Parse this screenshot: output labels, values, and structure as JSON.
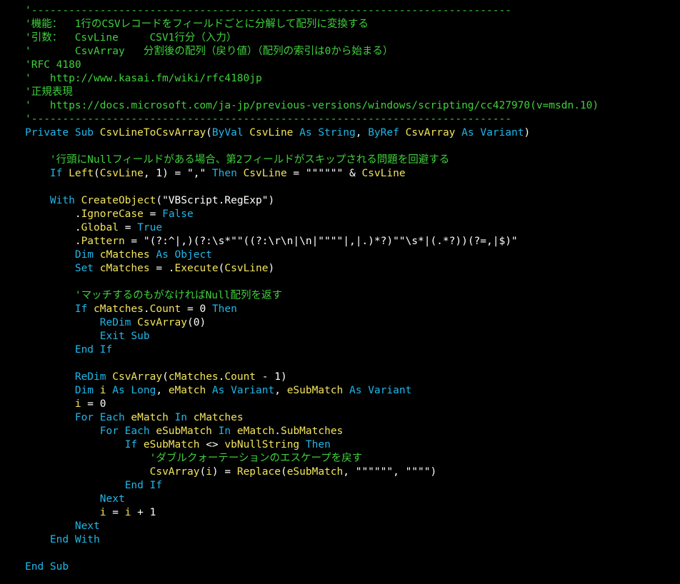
{
  "theme": {
    "background": "#000000",
    "keyword": "#1fb7e8",
    "identifier": "#f2e55c",
    "comment": "#3fd13c",
    "text": "#ffffff"
  },
  "lines": [
    [
      [
        "cm",
        "'-----------------------------------------------------------------------------"
      ]
    ],
    [
      [
        "cm",
        "'機能：  1行のCSVレコードをフィールドごとに分解して配列に変換する"
      ]
    ],
    [
      [
        "cm",
        "'引数：  CsvLine     CSV1行分（入力）"
      ]
    ],
    [
      [
        "cm",
        "'       CsvArray   分割後の配列（戻り値）（配列の索引は0から始まる）"
      ]
    ],
    [
      [
        "cm",
        "'RFC 4180"
      ]
    ],
    [
      [
        "cm",
        "'   http://www.kasai.fm/wiki/rfc4180jp"
      ]
    ],
    [
      [
        "cm",
        "'正規表現"
      ]
    ],
    [
      [
        "cm",
        "'   https://docs.microsoft.com/ja-jp/previous-versions/windows/scripting/cc427970(v=msdn.10)"
      ]
    ],
    [
      [
        "cm",
        "'-----------------------------------------------------------------------------"
      ]
    ],
    [
      [
        "kw",
        "Private Sub "
      ],
      [
        "id",
        "CsvLineToCsvArray"
      ],
      [
        "tx",
        "("
      ],
      [
        "kw",
        "ByVal "
      ],
      [
        "id",
        "CsvLine "
      ],
      [
        "kw",
        "As String"
      ],
      [
        "tx",
        ", "
      ],
      [
        "kw",
        "ByRef "
      ],
      [
        "id",
        "CsvArray "
      ],
      [
        "kw",
        "As Variant"
      ],
      [
        "tx",
        ")"
      ]
    ],
    [],
    [
      [
        "tx",
        "    "
      ],
      [
        "cm",
        "'行頭にNullフィールドがある場合、第2フィールドがスキップされる問題を回避する"
      ]
    ],
    [
      [
        "tx",
        "    "
      ],
      [
        "kw",
        "If "
      ],
      [
        "id",
        "Left"
      ],
      [
        "tx",
        "("
      ],
      [
        "id",
        "CsvLine"
      ],
      [
        "tx",
        ", 1) = \",\" "
      ],
      [
        "kw",
        "Then "
      ],
      [
        "id",
        "CsvLine"
      ],
      [
        "tx",
        " = \"\"\"\"\"\" & "
      ],
      [
        "id",
        "CsvLine"
      ]
    ],
    [],
    [
      [
        "tx",
        "    "
      ],
      [
        "kw",
        "With "
      ],
      [
        "id",
        "CreateObject"
      ],
      [
        "tx",
        "(\"VBScript.RegExp\")"
      ]
    ],
    [
      [
        "tx",
        "        ."
      ],
      [
        "id",
        "IgnoreCase"
      ],
      [
        "tx",
        " = "
      ],
      [
        "kw",
        "False"
      ]
    ],
    [
      [
        "tx",
        "        ."
      ],
      [
        "id",
        "Global"
      ],
      [
        "tx",
        " = "
      ],
      [
        "kw",
        "True"
      ]
    ],
    [
      [
        "tx",
        "        ."
      ],
      [
        "id",
        "Pattern"
      ],
      [
        "tx",
        " = \"(?:^|,)(?:\\s*\"\"((?:\\r\\n|\\n|\"\"\"\"|,|.)*?)\"\"\\s*|(.*?))(?=,|$)\""
      ]
    ],
    [
      [
        "tx",
        "        "
      ],
      [
        "kw",
        "Dim "
      ],
      [
        "id",
        "cMatches "
      ],
      [
        "kw",
        "As Object"
      ]
    ],
    [
      [
        "tx",
        "        "
      ],
      [
        "kw",
        "Set "
      ],
      [
        "id",
        "cMatches"
      ],
      [
        "tx",
        " = ."
      ],
      [
        "id",
        "Execute"
      ],
      [
        "tx",
        "("
      ],
      [
        "id",
        "CsvLine"
      ],
      [
        "tx",
        ")"
      ]
    ],
    [],
    [
      [
        "tx",
        "        "
      ],
      [
        "cm",
        "'マッチするのもがなければNull配列を返す"
      ]
    ],
    [
      [
        "tx",
        "        "
      ],
      [
        "kw",
        "If "
      ],
      [
        "id",
        "cMatches"
      ],
      [
        "tx",
        "."
      ],
      [
        "id",
        "Count"
      ],
      [
        "tx",
        " = 0 "
      ],
      [
        "kw",
        "Then"
      ]
    ],
    [
      [
        "tx",
        "            "
      ],
      [
        "kw",
        "ReDim "
      ],
      [
        "id",
        "CsvArray"
      ],
      [
        "tx",
        "(0)"
      ]
    ],
    [
      [
        "tx",
        "            "
      ],
      [
        "kw",
        "Exit Sub"
      ]
    ],
    [
      [
        "tx",
        "        "
      ],
      [
        "kw",
        "End If"
      ]
    ],
    [],
    [
      [
        "tx",
        "        "
      ],
      [
        "kw",
        "ReDim "
      ],
      [
        "id",
        "CsvArray"
      ],
      [
        "tx",
        "("
      ],
      [
        "id",
        "cMatches"
      ],
      [
        "tx",
        "."
      ],
      [
        "id",
        "Count"
      ],
      [
        "tx",
        " - 1)"
      ]
    ],
    [
      [
        "tx",
        "        "
      ],
      [
        "kw",
        "Dim "
      ],
      [
        "id",
        "i "
      ],
      [
        "kw",
        "As Long"
      ],
      [
        "tx",
        ", "
      ],
      [
        "id",
        "eMatch "
      ],
      [
        "kw",
        "As Variant"
      ],
      [
        "tx",
        ", "
      ],
      [
        "id",
        "eSubMatch "
      ],
      [
        "kw",
        "As Variant"
      ]
    ],
    [
      [
        "tx",
        "        "
      ],
      [
        "id",
        "i"
      ],
      [
        "tx",
        " = 0"
      ]
    ],
    [
      [
        "tx",
        "        "
      ],
      [
        "kw",
        "For Each "
      ],
      [
        "id",
        "eMatch "
      ],
      [
        "kw",
        "In "
      ],
      [
        "id",
        "cMatches"
      ]
    ],
    [
      [
        "tx",
        "            "
      ],
      [
        "kw",
        "For Each "
      ],
      [
        "id",
        "eSubMatch "
      ],
      [
        "kw",
        "In "
      ],
      [
        "id",
        "eMatch"
      ],
      [
        "tx",
        "."
      ],
      [
        "id",
        "SubMatches"
      ]
    ],
    [
      [
        "tx",
        "                "
      ],
      [
        "kw",
        "If "
      ],
      [
        "id",
        "eSubMatch"
      ],
      [
        "tx",
        " <> "
      ],
      [
        "id",
        "vbNullString "
      ],
      [
        "kw",
        "Then"
      ]
    ],
    [
      [
        "tx",
        "                    "
      ],
      [
        "cm",
        "'ダブルクォーテーションのエスケープを戻す"
      ]
    ],
    [
      [
        "tx",
        "                    "
      ],
      [
        "id",
        "CsvArray"
      ],
      [
        "tx",
        "("
      ],
      [
        "id",
        "i"
      ],
      [
        "tx",
        ") = "
      ],
      [
        "id",
        "Replace"
      ],
      [
        "tx",
        "("
      ],
      [
        "id",
        "eSubMatch"
      ],
      [
        "tx",
        ", \"\"\"\"\"\", \"\"\"\")"
      ]
    ],
    [
      [
        "tx",
        "                "
      ],
      [
        "kw",
        "End If"
      ]
    ],
    [
      [
        "tx",
        "            "
      ],
      [
        "kw",
        "Next"
      ]
    ],
    [
      [
        "tx",
        "            "
      ],
      [
        "id",
        "i"
      ],
      [
        "tx",
        " = "
      ],
      [
        "id",
        "i"
      ],
      [
        "tx",
        " + 1"
      ]
    ],
    [
      [
        "tx",
        "        "
      ],
      [
        "kw",
        "Next"
      ]
    ],
    [
      [
        "tx",
        "    "
      ],
      [
        "kw",
        "End With"
      ]
    ],
    [],
    [
      [
        "kw",
        "End Sub"
      ]
    ]
  ]
}
